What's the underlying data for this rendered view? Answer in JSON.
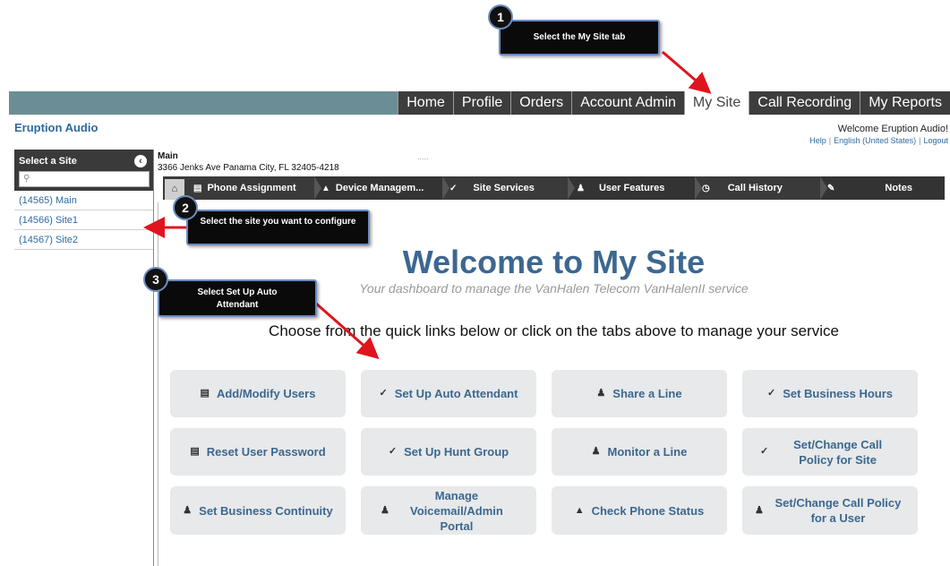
{
  "top_nav": {
    "tabs": [
      {
        "label": "Home"
      },
      {
        "label": "Profile"
      },
      {
        "label": "Orders"
      },
      {
        "label": "Account Admin"
      },
      {
        "label": "My Site",
        "active": true
      },
      {
        "label": "Call Recording"
      },
      {
        "label": "My Reports"
      }
    ]
  },
  "header": {
    "brand": "Eruption Audio",
    "welcome": "Welcome Eruption Audio!",
    "links": {
      "help": "Help",
      "language": "English (United States)",
      "logout": "Logout"
    }
  },
  "sidebar": {
    "title": "Select a Site",
    "collapse_icon": "chevron-left-icon",
    "search_icon": "magnifier-icon",
    "items": [
      {
        "label": "(14565) Main"
      },
      {
        "label": "(14566) Site1"
      },
      {
        "label": "(14567) Site2"
      }
    ]
  },
  "site": {
    "name": "Main",
    "address": "3366 Jenks Ave Panama City, FL 32405-4218",
    "dots": "....."
  },
  "sub_tabs": [
    {
      "label": "Phone Assignment",
      "icon": "table-icon"
    },
    {
      "label": "Device Managem...",
      "icon": "bell-icon"
    },
    {
      "label": "Site Services",
      "icon": "edit-icon"
    },
    {
      "label": "User Features",
      "icon": "user-icon"
    },
    {
      "label": "Call History",
      "icon": "clock-icon"
    },
    {
      "label": "Notes",
      "icon": "pencil-icon"
    }
  ],
  "main": {
    "title": "Welcome to My Site",
    "subtitle": "Your dashboard to manage the VanHalen Telecom VanHalenII service",
    "instruction": "Choose from the quick links below or click on the tabs above to manage your service"
  },
  "quick_links": [
    {
      "label": "Add/Modify Users",
      "icon": "table-icon"
    },
    {
      "label": "Set Up Auto Attendant",
      "icon": "edit-icon"
    },
    {
      "label": "Share a Line",
      "icon": "user-icon"
    },
    {
      "label": "Set Business Hours",
      "icon": "edit-icon"
    },
    {
      "label": "Reset User Password",
      "icon": "table-icon"
    },
    {
      "label": "Set Up Hunt Group",
      "icon": "edit-icon"
    },
    {
      "label": "Monitor a Line",
      "icon": "user-icon"
    },
    {
      "label": "Set/Change Call Policy for Site",
      "icon": "edit-icon"
    },
    {
      "label": "Set Business Continuity",
      "icon": "user-icon"
    },
    {
      "label": "Manage Voicemail/Admin Portal",
      "icon": "user-icon"
    },
    {
      "label": "Check Phone Status",
      "icon": "bell-icon"
    },
    {
      "label": "Set/Change Call Policy for a User",
      "icon": "user-icon"
    }
  ],
  "callouts": [
    {
      "number": "1",
      "text": "Select the My Site tab"
    },
    {
      "number": "2",
      "text": "Select the site you want to configure"
    },
    {
      "number": "3",
      "text": "Select Set Up Auto Attendant"
    }
  ],
  "colors": {
    "accent": "#3c6790",
    "nav_bg": "#6b8e96",
    "callout_arrow": "#e0141e"
  }
}
